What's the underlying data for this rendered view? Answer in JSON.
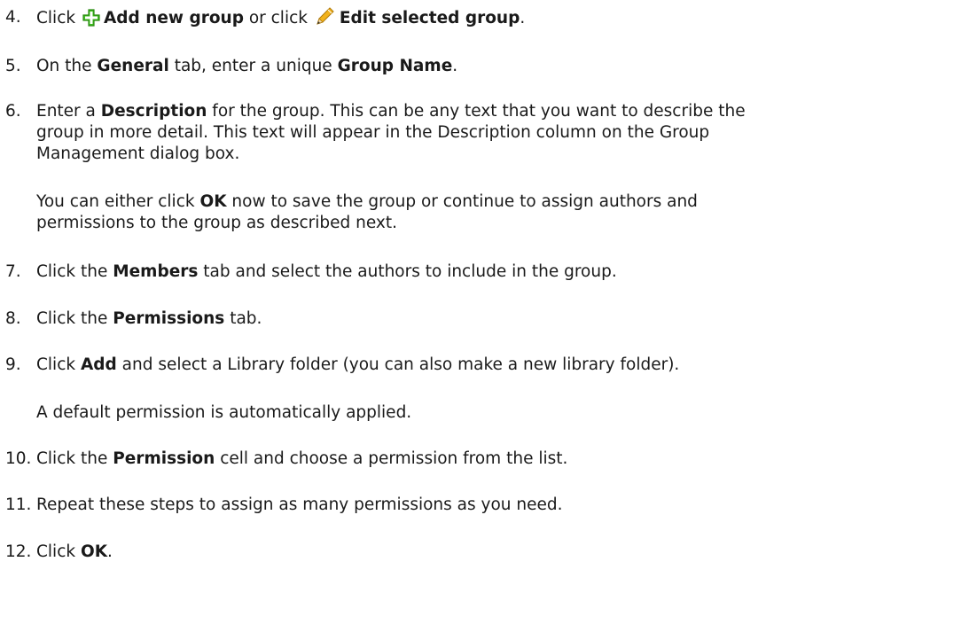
{
  "steps": [
    {
      "number": "4.",
      "parts": [
        {
          "t": "Click ",
          "b": false
        },
        {
          "icon": "add-icon"
        },
        {
          "t": "Add new group",
          "b": true
        },
        {
          "t": " or click ",
          "b": false
        },
        {
          "icon": "pencil-icon"
        },
        {
          "t": "Edit selected group",
          "b": true
        },
        {
          "t": ".",
          "b": false
        }
      ]
    },
    {
      "number": "5.",
      "parts": [
        {
          "t": "On the ",
          "b": false
        },
        {
          "t": "General",
          "b": true
        },
        {
          "t": " tab, enter a unique ",
          "b": false
        },
        {
          "t": "Group Name",
          "b": true
        },
        {
          "t": ".",
          "b": false
        }
      ]
    },
    {
      "number": "6.",
      "parts": [
        {
          "t": "Enter a ",
          "b": false
        },
        {
          "t": "Description",
          "b": true
        },
        {
          "t": " for the group. This can be any text that you want to describe the",
          "b": false
        }
      ],
      "lines": [
        "group in more detail. This text will appear in the Description column on the Group",
        "Management dialog box."
      ]
    },
    {
      "number": "7.",
      "parts": [
        {
          "t": "Click the ",
          "b": false
        },
        {
          "t": "Members",
          "b": true
        },
        {
          "t": " tab and select the authors to include in the group.",
          "b": false
        }
      ]
    },
    {
      "number": "8.",
      "parts": [
        {
          "t": "Click the ",
          "b": false
        },
        {
          "t": "Permissions",
          "b": true
        },
        {
          "t": " tab.",
          "b": false
        }
      ]
    },
    {
      "number": "9.",
      "parts": [
        {
          "t": "Click ",
          "b": false
        },
        {
          "t": "Add",
          "b": true
        },
        {
          "t": " and select a Library folder (you can also make a new library folder).",
          "b": false
        }
      ]
    },
    {
      "number": "10.",
      "parts": [
        {
          "t": "Click the ",
          "b": false
        },
        {
          "t": "Permission",
          "b": true
        },
        {
          "t": " cell and choose a permission from the list.",
          "b": false
        }
      ]
    },
    {
      "number": "11.",
      "parts": [
        {
          "t": "Repeat these steps to assign as many permissions as you need.",
          "b": false
        }
      ]
    },
    {
      "number": "12.",
      "parts": [
        {
          "t": "Click ",
          "b": false
        },
        {
          "t": "OK",
          "b": true
        },
        {
          "t": ".",
          "b": false
        }
      ]
    }
  ],
  "notes": {
    "ok_note": [
      {
        "t": "You can either click ",
        "b": false
      },
      {
        "t": "OK",
        "b": true
      },
      {
        "t": " now to save the group or continue to assign authors and",
        "b": false
      }
    ],
    "ok_note_line2": "permissions to the group as described next.",
    "default_permission": "A default permission is automatically applied."
  },
  "colors": {
    "text": "#1a1a1a",
    "add_icon": "#3fbf1f",
    "pencil_body": "#f2b21b",
    "pencil_tip": "#f1d7a8"
  }
}
